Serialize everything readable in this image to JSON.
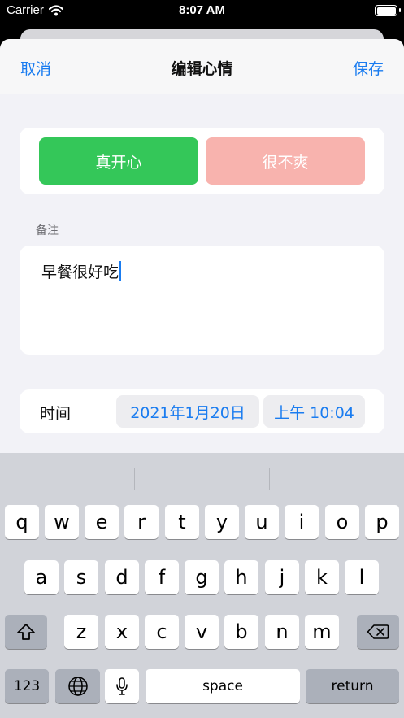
{
  "status_bar": {
    "carrier": "Carrier",
    "time": "8:07 AM"
  },
  "nav": {
    "cancel": "取消",
    "title": "编辑心情",
    "save": "保存"
  },
  "mood": {
    "happy": "真开心",
    "unhappy": "很不爽"
  },
  "note": {
    "label": "备注",
    "text": "早餐很好吃"
  },
  "time_row": {
    "label": "时间",
    "date": "2021年1月20日",
    "time": "上午 10:04"
  },
  "keyboard": {
    "row1": [
      "q",
      "w",
      "e",
      "r",
      "t",
      "y",
      "u",
      "i",
      "o",
      "p"
    ],
    "row2": [
      "a",
      "s",
      "d",
      "f",
      "g",
      "h",
      "j",
      "k",
      "l"
    ],
    "row3": [
      "z",
      "x",
      "c",
      "v",
      "b",
      "n",
      "m"
    ],
    "numbers": "123",
    "space": "space",
    "return": "return"
  },
  "colors": {
    "accent": "#1a7cf0",
    "happy": "#34c759",
    "unhappy": "#f8b3ae"
  }
}
